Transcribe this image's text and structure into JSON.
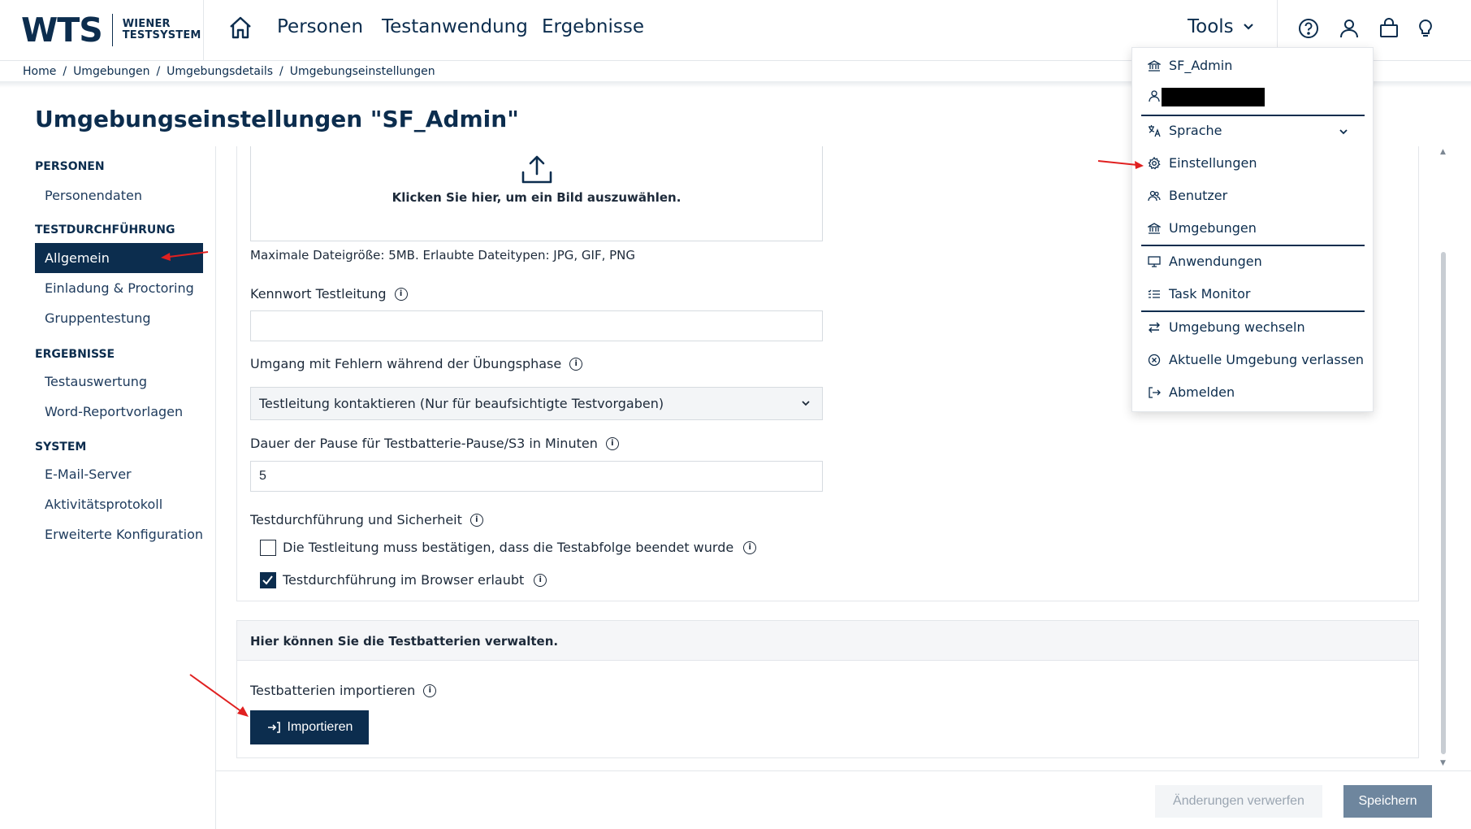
{
  "header": {
    "logo_mark": "WTS",
    "logo_line1": "WIENER",
    "logo_line2": "TESTSYSTEM",
    "nav": [
      "Personen",
      "Testanwendung",
      "Ergebnisse"
    ],
    "tools_label": "Tools"
  },
  "breadcrumb": [
    "Home",
    "/",
    "Umgebungen",
    "/",
    "Umgebungsdetails",
    "/",
    "Umgebungseinstellungen"
  ],
  "page_title": "Umgebungseinstellungen \"SF_Admin\"",
  "sidebar": {
    "sections": [
      {
        "title": "PERSONEN",
        "items": [
          "Personendaten"
        ]
      },
      {
        "title": "TESTDURCHFÜHRUNG",
        "items": [
          "Allgemein",
          "Einladung & Proctoring",
          "Gruppentestung"
        ]
      },
      {
        "title": "ERGEBNISSE",
        "items": [
          "Testauswertung",
          "Word-Reportvorlagen"
        ]
      },
      {
        "title": "SYSTEM",
        "items": [
          "E-Mail-Server",
          "Aktivitätsprotokoll",
          "Erweiterte Konfiguration"
        ]
      }
    ],
    "active_item": "Allgemein"
  },
  "form": {
    "upload_text": "Klicken Sie hier, um ein Bild auszuwählen.",
    "upload_hint": "Maximale Dateigröße: 5MB. Erlaubte Dateitypen: JPG, GIF, PNG",
    "password_label": "Kennwort Testleitung",
    "password_value": "",
    "error_label": "Umgang mit Fehlern während der Übungsphase",
    "error_selected": "Testleitung kontaktieren (Nur für beaufsichtigte Testvorgaben)",
    "pause_label": "Dauer der Pause für Testbatterie-Pause/S3 in Minuten",
    "pause_value": "5",
    "security_label": "Testdurchführung und Sicherheit",
    "checkbox1_label": "Die Testleitung muss bestätigen, dass die Testabfolge beendet wurde",
    "checkbox1_checked": false,
    "checkbox2_label": "Testdurchführung im Browser erlaubt",
    "checkbox2_checked": true
  },
  "batteries": {
    "header": "Hier können Sie die Testbatterien verwalten.",
    "import_label": "Testbatterien importieren",
    "import_button": "Importieren"
  },
  "footer": {
    "discard_button": "Änderungen verwerfen",
    "save_button": "Speichern"
  },
  "tools_menu": {
    "environment": "SF_Admin",
    "items": [
      {
        "label": "Sprache",
        "icon": "translate-icon"
      },
      {
        "label": "Einstellungen",
        "icon": "gear-icon"
      },
      {
        "label": "Benutzer",
        "icon": "users-icon"
      },
      {
        "label": "Umgebungen",
        "icon": "bank-icon"
      },
      {
        "label": "Anwendungen",
        "icon": "monitor-icon"
      },
      {
        "label": "Task Monitor",
        "icon": "list-icon"
      },
      {
        "label": "Umgebung wechseln",
        "icon": "swap-icon"
      },
      {
        "label": "Aktuelle Umgebung verlassen",
        "icon": "close-circle-icon"
      },
      {
        "label": "Abmelden",
        "icon": "logout-icon"
      }
    ]
  },
  "colors": {
    "primary": "#0c2d4e",
    "save_disabled": "#6e869e",
    "annotation_arrow": "#e02020"
  }
}
